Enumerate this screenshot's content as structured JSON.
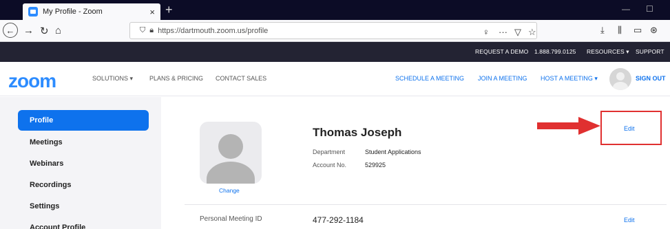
{
  "browser": {
    "tab_title": "My Profile - Zoom",
    "tab_close": "×",
    "new_tab": "+",
    "url": "https://dartmouth.zoom.us/profile",
    "minimize": "—",
    "maximize": "☐"
  },
  "topbar": {
    "request_demo": "REQUEST A DEMO",
    "phone": "1.888.799.0125",
    "resources": "RESOURCES ▾",
    "support": "SUPPORT"
  },
  "nav": {
    "logo": "zoom",
    "solutions": "SOLUTIONS ▾",
    "plans": "PLANS & PRICING",
    "contact": "CONTACT SALES",
    "schedule": "SCHEDULE A MEETING",
    "join": "JOIN A MEETING",
    "host": "HOST A MEETING ▾",
    "sign_out": "SIGN OUT"
  },
  "sidebar": {
    "items": [
      {
        "label": "Profile",
        "active": true
      },
      {
        "label": "Meetings"
      },
      {
        "label": "Webinars"
      },
      {
        "label": "Recordings"
      },
      {
        "label": "Settings"
      },
      {
        "label": "Account Profile"
      }
    ]
  },
  "profile": {
    "name": "Thomas Joseph",
    "department_label": "Department",
    "department_value": "Student Applications",
    "account_label": "Account No.",
    "account_value": "529925",
    "change_label": "Change",
    "edit_label": "Edit",
    "pmi_label": "Personal Meeting ID",
    "pmi_value": "477-292-1184",
    "pmi_edit_label": "Edit"
  },
  "colors": {
    "accent": "#0e72ed",
    "highlight": "#e03030",
    "topbar": "#232333"
  }
}
